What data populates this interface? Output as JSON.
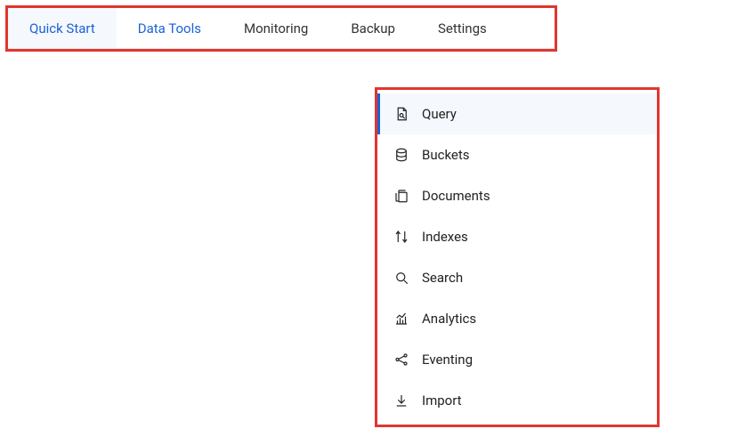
{
  "tabs": [
    {
      "label": "Quick Start",
      "state": "active"
    },
    {
      "label": "Data Tools",
      "state": "highlighted"
    },
    {
      "label": "Monitoring",
      "state": "normal"
    },
    {
      "label": "Backup",
      "state": "normal"
    },
    {
      "label": "Settings",
      "state": "normal"
    }
  ],
  "menu": [
    {
      "label": "Query",
      "active": true
    },
    {
      "label": "Buckets",
      "active": false
    },
    {
      "label": "Documents",
      "active": false
    },
    {
      "label": "Indexes",
      "active": false
    },
    {
      "label": "Search",
      "active": false
    },
    {
      "label": "Analytics",
      "active": false
    },
    {
      "label": "Eventing",
      "active": false
    },
    {
      "label": "Import",
      "active": false
    }
  ]
}
